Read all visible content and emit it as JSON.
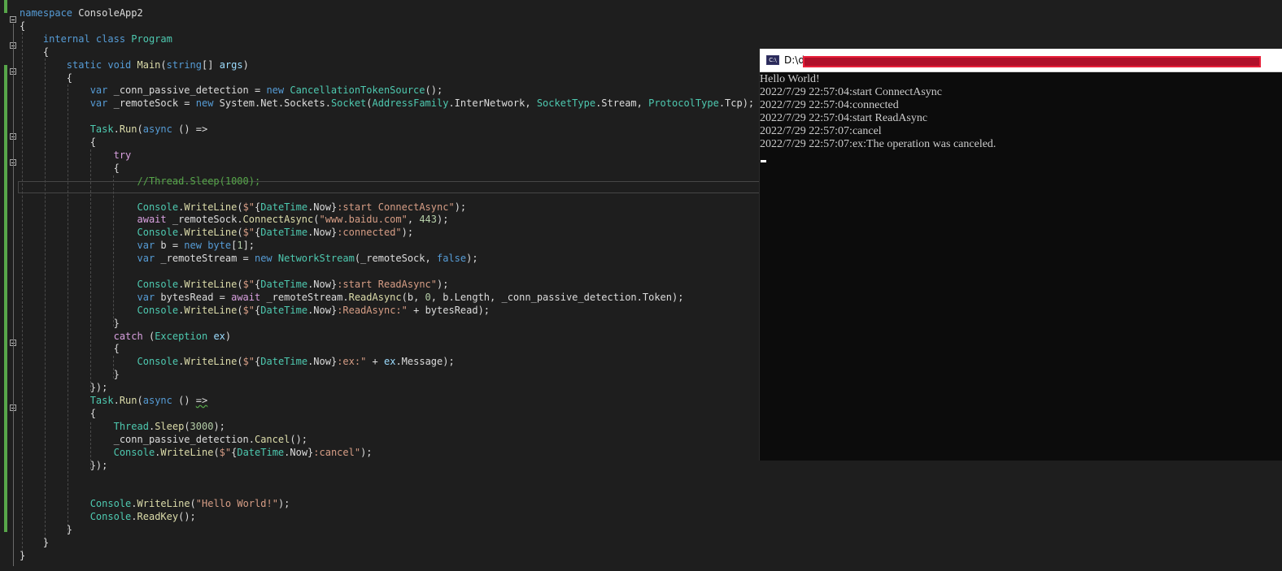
{
  "editor": {
    "lines": [
      [
        {
          "c": "kw",
          "t": "namespace"
        },
        {
          "c": "id",
          "t": " ConsoleApp2"
        }
      ],
      [
        {
          "c": "id",
          "t": "{"
        }
      ],
      [
        {
          "c": "kw",
          "t": "    internal class "
        },
        {
          "c": "ty",
          "t": "Program"
        }
      ],
      [
        {
          "c": "id",
          "t": "    {"
        }
      ],
      [
        {
          "c": "kw",
          "t": "        static void "
        },
        {
          "c": "fn",
          "t": "Main"
        },
        {
          "c": "id",
          "t": "("
        },
        {
          "c": "kw",
          "t": "string"
        },
        {
          "c": "id",
          "t": "[] "
        },
        {
          "c": "pm",
          "t": "args"
        },
        {
          "c": "id",
          "t": ")"
        }
      ],
      [
        {
          "c": "id",
          "t": "        {"
        }
      ],
      [
        {
          "c": "kw",
          "t": "            var "
        },
        {
          "c": "id",
          "t": "_conn_passive_detection = "
        },
        {
          "c": "kw",
          "t": "new "
        },
        {
          "c": "ty",
          "t": "CancellationTokenSource"
        },
        {
          "c": "id",
          "t": "();"
        }
      ],
      [
        {
          "c": "kw",
          "t": "            var "
        },
        {
          "c": "id",
          "t": "_remoteSock = "
        },
        {
          "c": "kw",
          "t": "new "
        },
        {
          "c": "id",
          "t": "System.Net.Sockets."
        },
        {
          "c": "ty",
          "t": "Socket"
        },
        {
          "c": "id",
          "t": "("
        },
        {
          "c": "ty",
          "t": "AddressFamily"
        },
        {
          "c": "id",
          "t": ".InterNetwork, "
        },
        {
          "c": "ty",
          "t": "SocketType"
        },
        {
          "c": "id",
          "t": ".Stream, "
        },
        {
          "c": "ty",
          "t": "ProtocolType"
        },
        {
          "c": "id",
          "t": ".Tcp);"
        }
      ],
      [
        {
          "c": "id",
          "t": ""
        }
      ],
      [
        {
          "c": "ty",
          "t": "            Task"
        },
        {
          "c": "id",
          "t": "."
        },
        {
          "c": "fn",
          "t": "Run"
        },
        {
          "c": "id",
          "t": "("
        },
        {
          "c": "kw",
          "t": "async"
        },
        {
          "c": "id",
          "t": " () =>"
        }
      ],
      [
        {
          "c": "id",
          "t": "            {"
        }
      ],
      [
        {
          "c": "kw2",
          "t": "                try"
        }
      ],
      [
        {
          "c": "id",
          "t": "                {"
        }
      ],
      [
        {
          "c": "cm",
          "t": "                    //Thread.Sleep(1000);"
        }
      ],
      [
        {
          "c": "id",
          "t": ""
        }
      ],
      [
        {
          "c": "ty",
          "t": "                    Console"
        },
        {
          "c": "id",
          "t": "."
        },
        {
          "c": "fn",
          "t": "WriteLine"
        },
        {
          "c": "id",
          "t": "("
        },
        {
          "c": "st",
          "t": "$\""
        },
        {
          "c": "id",
          "t": "{"
        },
        {
          "c": "ty",
          "t": "DateTime"
        },
        {
          "c": "id",
          "t": ".Now}"
        },
        {
          "c": "st",
          "t": ":start ConnectAsync\""
        },
        {
          "c": "id",
          "t": ");"
        }
      ],
      [
        {
          "c": "kw2",
          "t": "                    await "
        },
        {
          "c": "id",
          "t": "_remoteSock."
        },
        {
          "c": "fn",
          "t": "ConnectAsync"
        },
        {
          "c": "id",
          "t": "("
        },
        {
          "c": "st",
          "t": "\"www.baidu.com\""
        },
        {
          "c": "id",
          "t": ", "
        },
        {
          "c": "nm",
          "t": "443"
        },
        {
          "c": "id",
          "t": ");"
        }
      ],
      [
        {
          "c": "ty",
          "t": "                    Console"
        },
        {
          "c": "id",
          "t": "."
        },
        {
          "c": "fn",
          "t": "WriteLine"
        },
        {
          "c": "id",
          "t": "("
        },
        {
          "c": "st",
          "t": "$\""
        },
        {
          "c": "id",
          "t": "{"
        },
        {
          "c": "ty",
          "t": "DateTime"
        },
        {
          "c": "id",
          "t": ".Now}"
        },
        {
          "c": "st",
          "t": ":connected\""
        },
        {
          "c": "id",
          "t": ");"
        }
      ],
      [
        {
          "c": "kw",
          "t": "                    var "
        },
        {
          "c": "id",
          "t": "b = "
        },
        {
          "c": "kw",
          "t": "new byte"
        },
        {
          "c": "id",
          "t": "["
        },
        {
          "c": "nm",
          "t": "1"
        },
        {
          "c": "id",
          "t": "];"
        }
      ],
      [
        {
          "c": "kw",
          "t": "                    var "
        },
        {
          "c": "id",
          "t": "_remoteStream = "
        },
        {
          "c": "kw",
          "t": "new "
        },
        {
          "c": "ty",
          "t": "NetworkStream"
        },
        {
          "c": "id",
          "t": "(_remoteSock, "
        },
        {
          "c": "kw",
          "t": "false"
        },
        {
          "c": "id",
          "t": ");"
        }
      ],
      [
        {
          "c": "id",
          "t": ""
        }
      ],
      [
        {
          "c": "ty",
          "t": "                    Console"
        },
        {
          "c": "id",
          "t": "."
        },
        {
          "c": "fn",
          "t": "WriteLine"
        },
        {
          "c": "id",
          "t": "("
        },
        {
          "c": "st",
          "t": "$\""
        },
        {
          "c": "id",
          "t": "{"
        },
        {
          "c": "ty",
          "t": "DateTime"
        },
        {
          "c": "id",
          "t": ".Now}"
        },
        {
          "c": "st",
          "t": ":start ReadAsync\""
        },
        {
          "c": "id",
          "t": ");"
        }
      ],
      [
        {
          "c": "kw",
          "t": "                    var "
        },
        {
          "c": "id",
          "t": "bytesRead = "
        },
        {
          "c": "kw2",
          "t": "await "
        },
        {
          "c": "id",
          "t": "_remoteStream."
        },
        {
          "c": "fn",
          "t": "ReadAsync"
        },
        {
          "c": "id",
          "t": "(b, "
        },
        {
          "c": "nm",
          "t": "0"
        },
        {
          "c": "id",
          "t": ", b.Length, _conn_passive_detection.Token);"
        }
      ],
      [
        {
          "c": "ty",
          "t": "                    Console"
        },
        {
          "c": "id",
          "t": "."
        },
        {
          "c": "fn",
          "t": "WriteLine"
        },
        {
          "c": "id",
          "t": "("
        },
        {
          "c": "st",
          "t": "$\""
        },
        {
          "c": "id",
          "t": "{"
        },
        {
          "c": "ty",
          "t": "DateTime"
        },
        {
          "c": "id",
          "t": ".Now}"
        },
        {
          "c": "st",
          "t": ":ReadAsync:\""
        },
        {
          "c": "id",
          "t": " + bytesRead);"
        }
      ],
      [
        {
          "c": "id",
          "t": "                }"
        }
      ],
      [
        {
          "c": "kw2",
          "t": "                catch "
        },
        {
          "c": "id",
          "t": "("
        },
        {
          "c": "ty",
          "t": "Exception"
        },
        {
          "c": "id",
          "t": " "
        },
        {
          "c": "pm",
          "t": "ex"
        },
        {
          "c": "id",
          "t": ")"
        }
      ],
      [
        {
          "c": "id",
          "t": "                {"
        }
      ],
      [
        {
          "c": "ty",
          "t": "                    Console"
        },
        {
          "c": "id",
          "t": "."
        },
        {
          "c": "fn",
          "t": "WriteLine"
        },
        {
          "c": "id",
          "t": "("
        },
        {
          "c": "st",
          "t": "$\""
        },
        {
          "c": "id",
          "t": "{"
        },
        {
          "c": "ty",
          "t": "DateTime"
        },
        {
          "c": "id",
          "t": ".Now}"
        },
        {
          "c": "st",
          "t": ":ex:\""
        },
        {
          "c": "id",
          "t": " + "
        },
        {
          "c": "pm",
          "t": "ex"
        },
        {
          "c": "id",
          "t": ".Message);"
        }
      ],
      [
        {
          "c": "id",
          "t": "                }"
        }
      ],
      [
        {
          "c": "id",
          "t": "            });"
        }
      ],
      [
        {
          "c": "ty",
          "t": "            Task"
        },
        {
          "c": "id",
          "t": "."
        },
        {
          "c": "fn",
          "t": "Run"
        },
        {
          "c": "id",
          "t": "("
        },
        {
          "c": "kw",
          "t": "async"
        },
        {
          "c": "id",
          "t": " () "
        },
        {
          "c": "id squig",
          "t": "=>"
        }
      ],
      [
        {
          "c": "id",
          "t": "            {"
        }
      ],
      [
        {
          "c": "ty",
          "t": "                Thread"
        },
        {
          "c": "id",
          "t": "."
        },
        {
          "c": "fn",
          "t": "Sleep"
        },
        {
          "c": "id",
          "t": "("
        },
        {
          "c": "nm",
          "t": "3000"
        },
        {
          "c": "id",
          "t": ");"
        }
      ],
      [
        {
          "c": "id",
          "t": "                _conn_passive_detection."
        },
        {
          "c": "fn",
          "t": "Cancel"
        },
        {
          "c": "id",
          "t": "();"
        }
      ],
      [
        {
          "c": "ty",
          "t": "                Console"
        },
        {
          "c": "id",
          "t": "."
        },
        {
          "c": "fn",
          "t": "WriteLine"
        },
        {
          "c": "id",
          "t": "("
        },
        {
          "c": "st",
          "t": "$\""
        },
        {
          "c": "id",
          "t": "{"
        },
        {
          "c": "ty",
          "t": "DateTime"
        },
        {
          "c": "id",
          "t": ".Now}"
        },
        {
          "c": "st",
          "t": ":cancel\""
        },
        {
          "c": "id",
          "t": ");"
        }
      ],
      [
        {
          "c": "id",
          "t": "            });"
        }
      ],
      [
        {
          "c": "id",
          "t": ""
        }
      ],
      [
        {
          "c": "id",
          "t": ""
        }
      ],
      [
        {
          "c": "ty",
          "t": "            Console"
        },
        {
          "c": "id",
          "t": "."
        },
        {
          "c": "fn",
          "t": "WriteLine"
        },
        {
          "c": "id",
          "t": "("
        },
        {
          "c": "st",
          "t": "\"Hello World!\""
        },
        {
          "c": "id",
          "t": ");"
        }
      ],
      [
        {
          "c": "ty",
          "t": "            Console"
        },
        {
          "c": "id",
          "t": "."
        },
        {
          "c": "fn",
          "t": "ReadKey"
        },
        {
          "c": "id",
          "t": "();"
        }
      ],
      [
        {
          "c": "id",
          "t": "        }"
        }
      ],
      [
        {
          "c": "id",
          "t": "    }"
        }
      ],
      [
        {
          "c": "id",
          "t": "}"
        }
      ]
    ]
  },
  "console": {
    "icon_text": "C:\\",
    "title": "D:\\d",
    "output": [
      "Hello World!",
      "2022/7/29 22:57:04:start ConnectAsync",
      "2022/7/29 22:57:04:connected",
      "2022/7/29 22:57:04:start ReadAsync",
      "2022/7/29 22:57:07:cancel",
      "2022/7/29 22:57:07:ex:The operation was canceled."
    ]
  },
  "colors": {
    "editor_bg": "#1e1e1e",
    "console_bg": "#0c0c0c",
    "console_text": "#cccccc",
    "keyword": "#569cd6",
    "control_keyword": "#d8a0df",
    "type": "#4ec9b0",
    "method": "#dcdcaa",
    "string": "#d69d85",
    "comment": "#57a64a",
    "redaction": "#b0102a"
  }
}
